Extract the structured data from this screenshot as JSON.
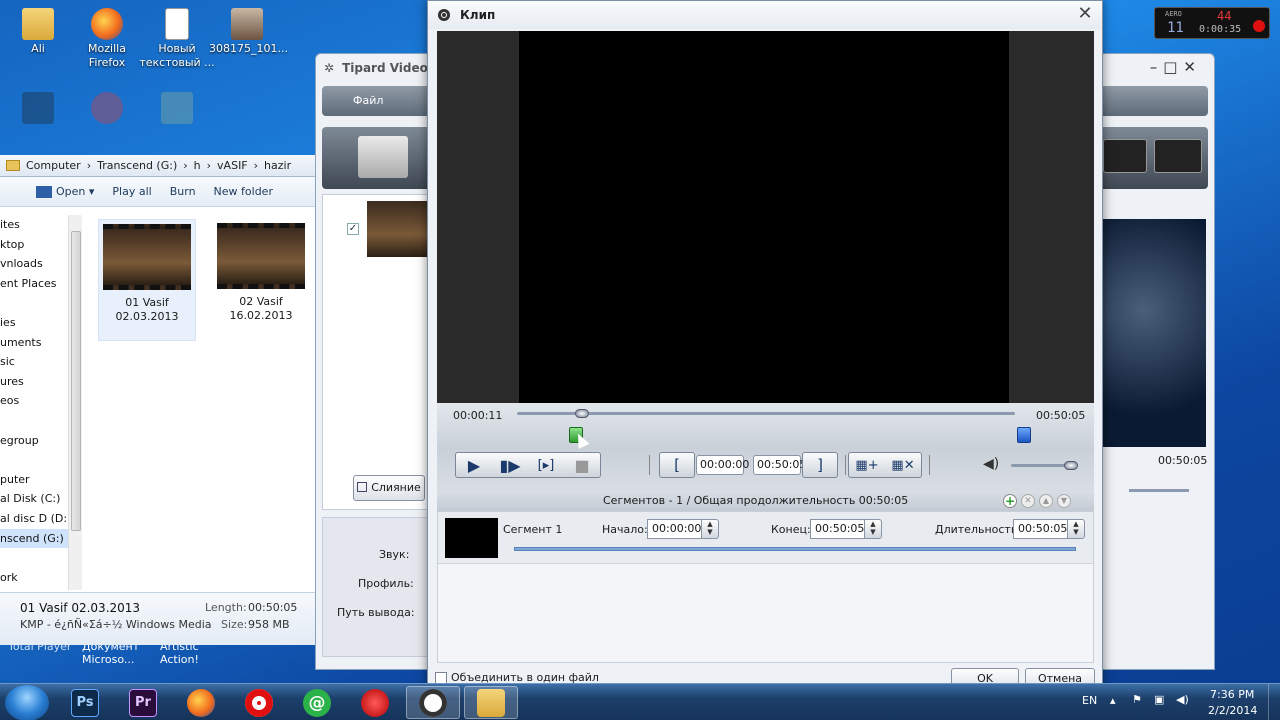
{
  "desktop": {
    "icons": [
      {
        "label": "Ali"
      },
      {
        "label": "Mozilla\nFirefox"
      },
      {
        "label": "Новый\nтекстовый ..."
      },
      {
        "label": "308175_101..."
      }
    ],
    "behind_labels": [
      "Total Player",
      "Документ\nMicroso...",
      "Artistic\nAction!"
    ]
  },
  "explorer": {
    "breadcrumb": [
      "Computer",
      "Transcend (G:)",
      "h",
      "vASIF",
      "hazir"
    ],
    "toolbar": {
      "open": "Open",
      "play_all": "Play all",
      "burn": "Burn",
      "new_folder": "New folder"
    },
    "nav": [
      "ites",
      "ktop",
      "vnloads",
      "ent Places",
      "",
      "ies",
      "uments",
      "sic",
      "ures",
      "eos",
      "",
      "egroup",
      "",
      "puter",
      "al Disk (C:)",
      "al disc D (D:)",
      "nscend (G:)",
      "",
      "ork"
    ],
    "files": [
      {
        "name": "01  Vasif",
        "date": "02.03.2013"
      },
      {
        "name": "02 Vasif",
        "date": "16.02.2013"
      }
    ],
    "details": {
      "name": "01  Vasif 02.03.2013",
      "type": "KMP - é¿ñÑ«Σá÷½ Windows Media",
      "length_label": "Length:",
      "length": "00:50:05",
      "size_label": "Size:",
      "size": "958 MB"
    }
  },
  "tipard": {
    "title": "Tipard Video",
    "menu_file": "Файл",
    "merge_button": "Слияние",
    "audio_label": "Звук:",
    "profile_label": "Профиль:",
    "output_label": "Путь вывода:",
    "right_time": "00:50:05"
  },
  "clip": {
    "title": "Клип",
    "current_time": "00:00:11",
    "total_time": "00:50:05",
    "start_time": "00:00:00",
    "end_time": "00:50:05",
    "play_progress": 0.13,
    "segments_summary": "Сегментов - 1 / Общая продолжительность 00:50:05",
    "segment": {
      "name": "Сегмент 1",
      "start_label": "Начало:",
      "start": "00:00:00",
      "end_label": "Конец:",
      "end": "00:50:05",
      "duration_label": "Длительность:",
      "duration": "00:50:05"
    },
    "merge_checkbox": "Объединить в один файл",
    "ok": "OK",
    "cancel": "Отмена"
  },
  "gadget": {
    "label": "AERO",
    "value1": "11",
    "value2": "44",
    "timer": "0:00:35"
  },
  "taskbar": {
    "lang": "EN",
    "time": "7:36 PM",
    "date": "2/2/2014",
    "apps": [
      "Ps",
      "Pr",
      "Firefox",
      "Opera",
      "@",
      "Record",
      "Reel",
      "Folder"
    ]
  }
}
